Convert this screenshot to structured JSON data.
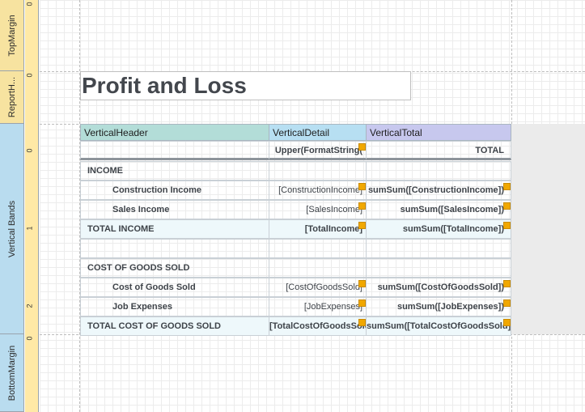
{
  "bands": {
    "top_margin": "TopMargin",
    "report_header": "ReportH...",
    "vertical_bands": "Vertical Bands",
    "bottom_margin": "BottomMargin"
  },
  "ruler": {
    "top": "0",
    "rh": "0",
    "vb0": "0",
    "vb1": "1",
    "vb2": "2",
    "bm": "0"
  },
  "report": {
    "title": "Profit and Loss"
  },
  "table": {
    "headers": {
      "vertical_header": "VerticalHeader",
      "vertical_detail": "VerticalDetail",
      "vertical_total": "VerticalTotal"
    },
    "rows": [
      {
        "label": "",
        "detail": "Upper(FormatString(",
        "total": "TOTAL"
      },
      {
        "label": "INCOME",
        "detail": "",
        "total": ""
      },
      {
        "label": "Construction Income",
        "detail": "[ConstructionIncome]",
        "total": "sumSum([ConstructionIncome])"
      },
      {
        "label": "Sales Income",
        "detail": "[SalesIncome]",
        "total": "sumSum([SalesIncome])"
      },
      {
        "label": "TOTAL INCOME",
        "detail": "[TotalIncome]",
        "total": "sumSum([TotalIncome])"
      },
      {
        "label": "",
        "detail": "",
        "total": ""
      },
      {
        "label": "COST OF GOODS SOLD",
        "detail": "",
        "total": ""
      },
      {
        "label": "Cost of Goods Sold",
        "detail": "[CostOfGoodsSold]",
        "total": "sumSum([CostOfGoodsSold])"
      },
      {
        "label": "Job Expenses",
        "detail": "[JobExpenses]",
        "total": "sumSum([JobExpenses])"
      },
      {
        "label": "TOTAL COST OF GOODS SOLD",
        "detail": "[TotalCostOfGoodsSold]",
        "total": "sumSum([TotalCostOfGoodsSold])"
      }
    ]
  },
  "colors": {
    "band_yellow": "#f7e3a0",
    "band_blue": "#b9dcef",
    "header_vertical": "#b3ddd8",
    "header_detail": "#b7dff2",
    "header_total": "#c7c8ee",
    "marker": "#f1a800"
  }
}
